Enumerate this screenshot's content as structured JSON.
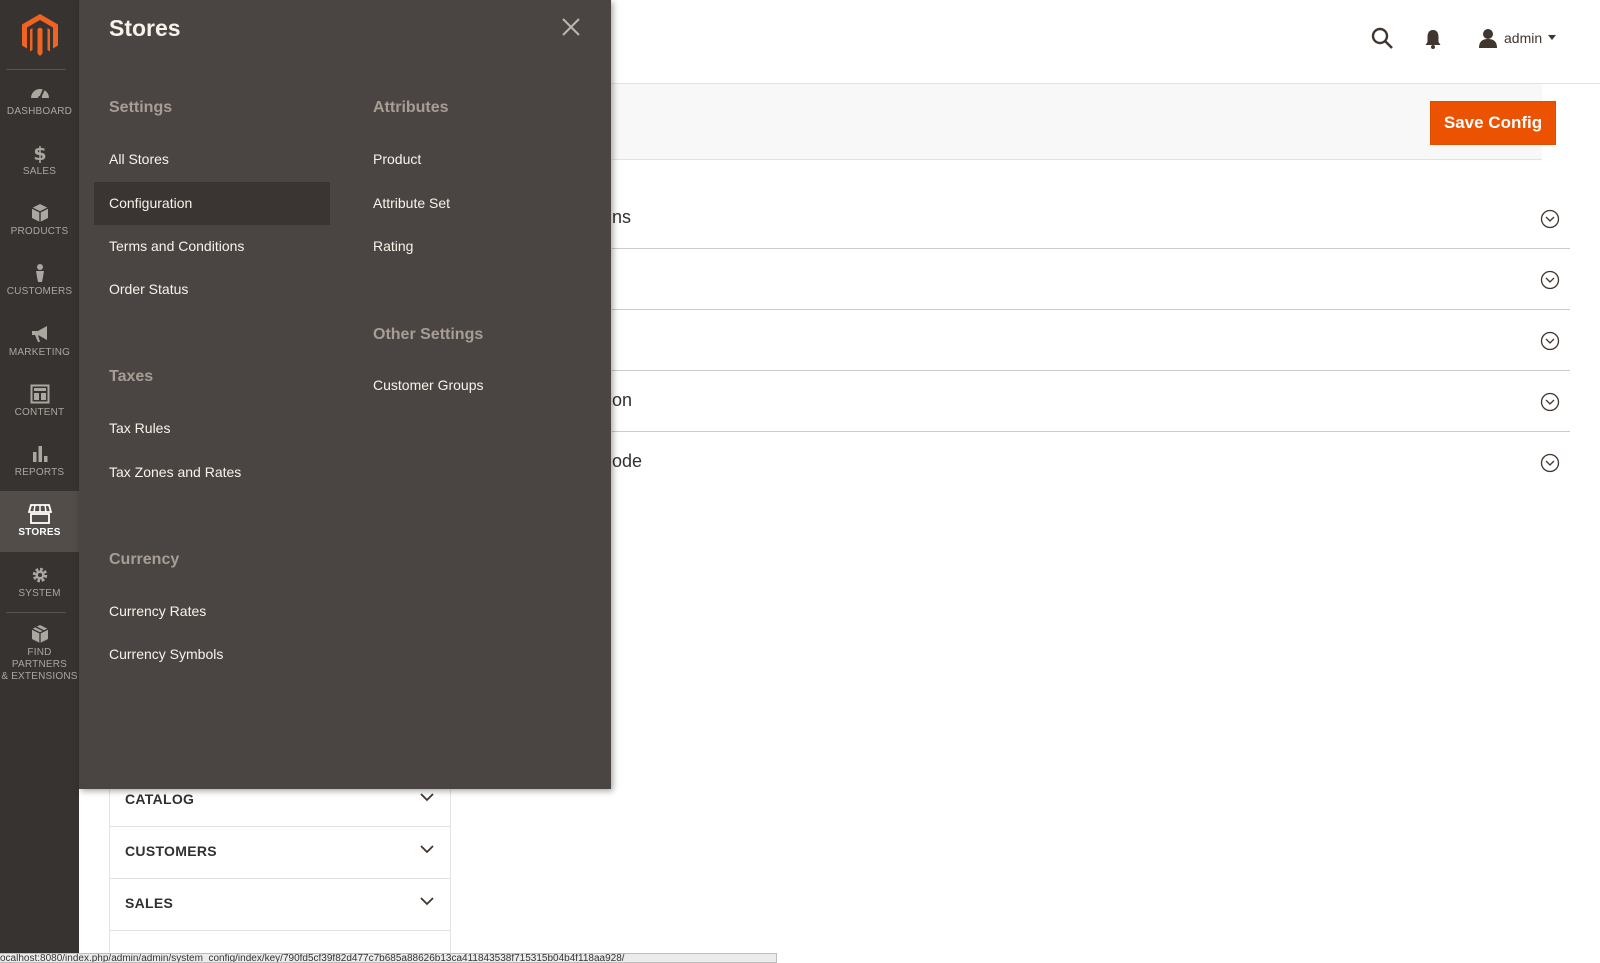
{
  "nav": {
    "items": [
      {
        "label": "DASHBOARD",
        "icon": "dashboard-icon"
      },
      {
        "label": "SALES",
        "icon": "dollar-icon"
      },
      {
        "label": "PRODUCTS",
        "icon": "cube-icon"
      },
      {
        "label": "CUSTOMERS",
        "icon": "person-icon"
      },
      {
        "label": "MARKETING",
        "icon": "megaphone-icon"
      },
      {
        "label": "CONTENT",
        "icon": "layout-icon"
      },
      {
        "label": "REPORTS",
        "icon": "bar-chart-icon"
      },
      {
        "label": "STORES",
        "icon": "storefront-icon",
        "active": true
      },
      {
        "label": "SYSTEM",
        "icon": "gear-icon"
      },
      {
        "label_line1": "FIND PARTNERS",
        "label_line2": "& EXTENSIONS",
        "icon": "box-icon"
      }
    ]
  },
  "header": {
    "user": "admin"
  },
  "action": {
    "save_label": "Save Config"
  },
  "sections": [
    {
      "title_visible": "ns"
    },
    {
      "title_visible": ""
    },
    {
      "title_visible": ""
    },
    {
      "title_visible": "on"
    },
    {
      "title_visible": "ode"
    }
  ],
  "config_tabs": [
    {
      "label": "CATALOG"
    },
    {
      "label": "CUSTOMERS"
    },
    {
      "label": "SALES"
    }
  ],
  "flyout": {
    "title": "Stores",
    "settings": {
      "heading": "Settings",
      "links": [
        "All Stores",
        "Configuration",
        "Terms and Conditions",
        "Order Status"
      ]
    },
    "taxes": {
      "heading": "Taxes",
      "links": [
        "Tax Rules",
        "Tax Zones and Rates"
      ]
    },
    "currency": {
      "heading": "Currency",
      "links": [
        "Currency Rates",
        "Currency Symbols"
      ]
    },
    "attributes": {
      "heading": "Attributes",
      "links": [
        "Product",
        "Attribute Set",
        "Rating"
      ]
    },
    "other": {
      "heading": "Other Settings",
      "links": [
        "Customer Groups"
      ]
    }
  },
  "status_url": "ocalhost:8080/index.php/admin/admin/system_config/index/key/790fd5cf39f82d477c7b685a88626b13ca411843538f715315b04b4f118aa928/",
  "colors": {
    "accent": "#eb5202",
    "nav_bg": "#373330",
    "flyout_bg": "#4a4542"
  }
}
